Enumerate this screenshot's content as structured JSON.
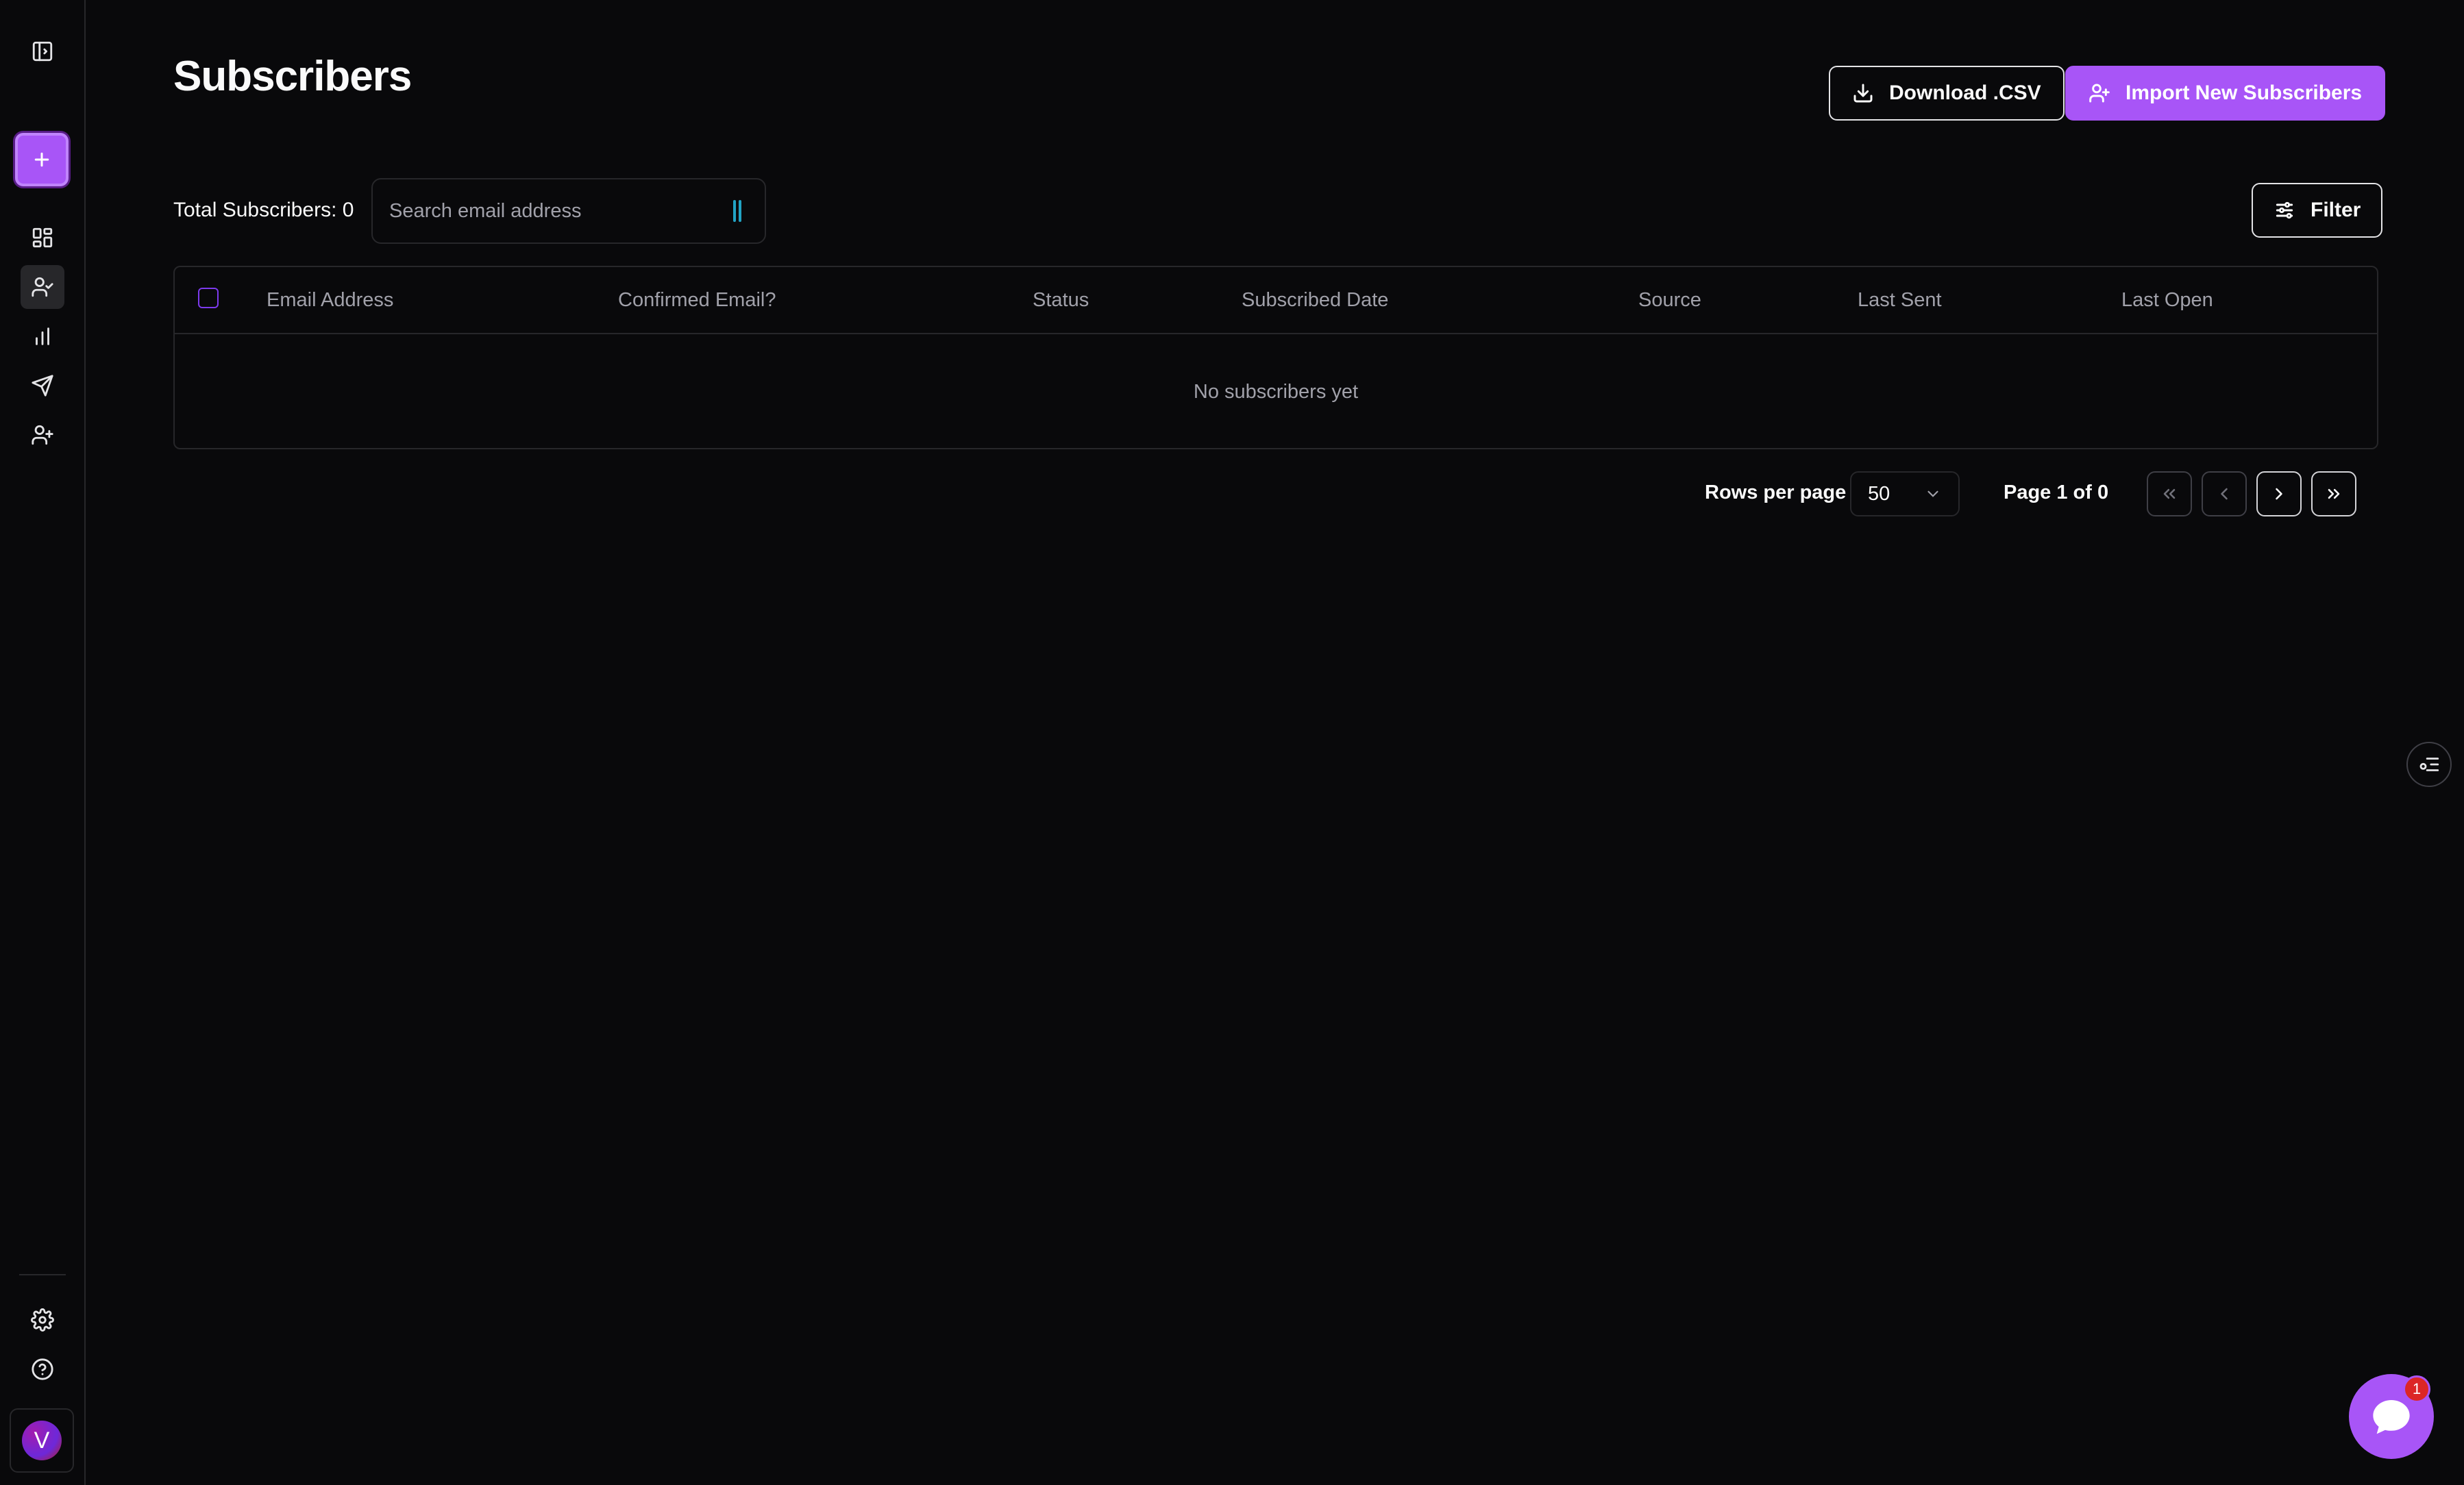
{
  "page": {
    "title": "Subscribers"
  },
  "actions": {
    "download_label": "Download .CSV",
    "import_label": "Import New Subscribers",
    "filter_label": "Filter"
  },
  "summary": {
    "total_label": "Total Subscribers: 0"
  },
  "search": {
    "placeholder": "Search email address",
    "value": ""
  },
  "table": {
    "columns": [
      "Email Address",
      "Confirmed Email?",
      "Status",
      "Subscribed Date",
      "Source",
      "Last Sent",
      "Last Open"
    ],
    "rows": [],
    "empty_message": "No subscribers yet"
  },
  "pagination": {
    "rows_per_page_label": "Rows per page",
    "rows_per_page_value": "50",
    "page_info": "Page 1 of 0"
  },
  "user": {
    "avatar_initial": "V"
  },
  "chat": {
    "badge_count": "1"
  },
  "colors": {
    "accent": "#a855f7",
    "background": "#09090b",
    "border": "#27272a",
    "badge": "#dc2626"
  },
  "icons": {
    "sidebar": [
      "sidebar-toggle-icon",
      "plus-icon",
      "dashboard-icon",
      "subscribers-icon",
      "analytics-icon",
      "send-icon",
      "add-user-icon",
      "settings-icon",
      "help-icon"
    ],
    "actions": [
      "download-icon",
      "user-plus-icon",
      "sliders-icon"
    ],
    "pagination": [
      "chevrons-left-icon",
      "chevron-left-icon",
      "chevron-right-icon",
      "chevrons-right-icon"
    ]
  }
}
